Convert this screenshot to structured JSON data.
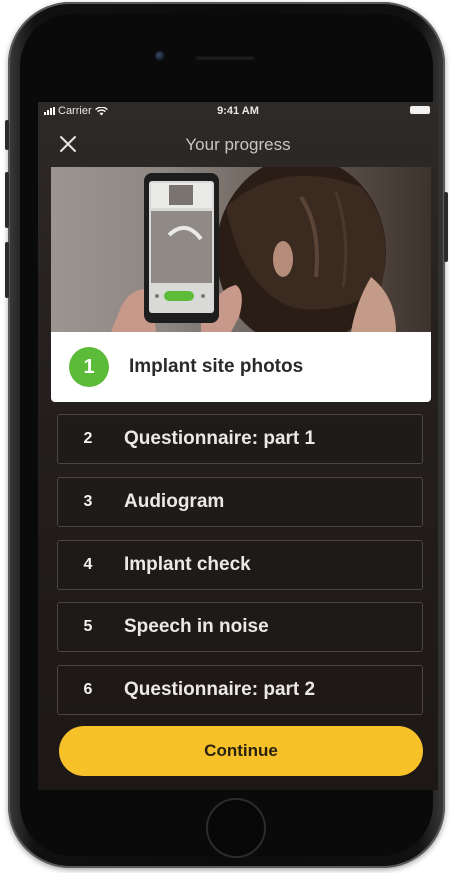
{
  "status_bar": {
    "carrier": "Carrier",
    "time": "9:41 AM"
  },
  "header": {
    "title": "Your progress",
    "close_icon": "close-icon"
  },
  "steps": [
    {
      "number": "1",
      "label": "Implant site photos",
      "state": "active"
    },
    {
      "number": "2",
      "label": "Questionnaire: part 1",
      "state": "pending"
    },
    {
      "number": "3",
      "label": "Audiogram",
      "state": "pending"
    },
    {
      "number": "4",
      "label": "Implant check",
      "state": "pending"
    },
    {
      "number": "5",
      "label": "Speech in noise",
      "state": "pending"
    },
    {
      "number": "6",
      "label": "Questionnaire: part 2",
      "state": "pending"
    }
  ],
  "footer": {
    "continue_label": "Continue"
  },
  "colors": {
    "accent": "#f7c12a",
    "active_step": "#5dbb3a"
  }
}
